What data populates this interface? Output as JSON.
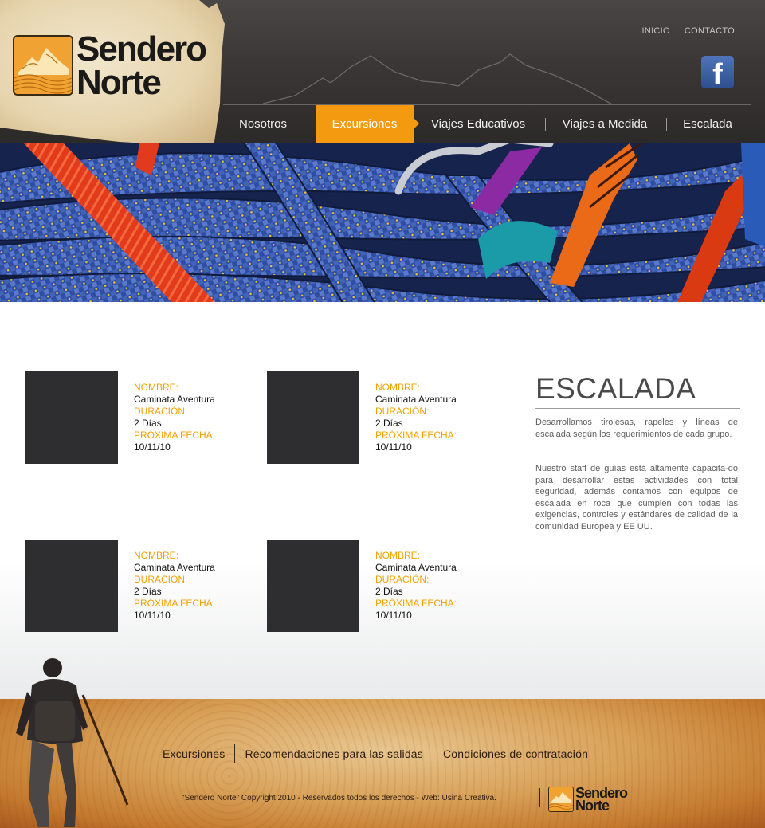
{
  "brand": {
    "name_line1": "Sendero",
    "name_line2": "Norte"
  },
  "top_links": [
    "INICIO",
    "CONTACTO"
  ],
  "social": {
    "facebook_icon": "facebook-icon",
    "glyph": "f"
  },
  "nav": {
    "items": [
      "Nosotros",
      "Excursiones",
      "Viajes Educativos",
      "Viajes a Medida",
      "Escalada"
    ],
    "active": "Excursiones"
  },
  "banner": {
    "image": "climbing-ropes-and-carabiners-photo"
  },
  "cards": [
    {
      "label_name": "NOMBRE:",
      "name": "Caminata Aventura",
      "label_duration": "DURACIÓN:",
      "duration": "2 Días",
      "label_date": "PRÓXIMA FECHA:",
      "date": "10/11/10"
    },
    {
      "label_name": "NOMBRE:",
      "name": "Caminata Aventura",
      "label_duration": "DURACIÓN:",
      "duration": "2 Días",
      "label_date": "PRÓXIMA FECHA:",
      "date": "10/11/10"
    },
    {
      "label_name": "NOMBRE:",
      "name": "Caminata Aventura",
      "label_duration": "DURACIÓN:",
      "duration": "2 Días",
      "label_date": "PRÓXIMA FECHA:",
      "date": "10/11/10"
    },
    {
      "label_name": "NOMBRE:",
      "name": "Caminata Aventura",
      "label_duration": "DURACIÓN:",
      "duration": "2 Días",
      "label_date": "PRÓXIMA FECHA:",
      "date": "10/11/10"
    }
  ],
  "section": {
    "title": "ESCALADA",
    "paragraph1": "Desarrollamos tirolesas, rapeles y líneas de escalada según los requerimientos de cada grupo.",
    "paragraph2": "Nuestro staff de guías está altamente capacita-do para desarrollar estas actividades con total seguridad, además contamos con equipos de escalada en roca que cumplen con todas las exigencias, controles y estándares de calidad de la comunidad Europea y EE UU."
  },
  "footer": {
    "links": [
      "Excursiones",
      "Recomendaciones para las salidas",
      "Condiciones de contratación"
    ],
    "copyright": "\"Sendero Norte\" Copyright 2010 - Reservados todos los derechos - Web: Usina Creativa.",
    "logo_line1": "Sendero",
    "logo_line2": "Norte"
  },
  "colors": {
    "accent": "#f39a11",
    "header": "#3a3736",
    "card_thumb": "#2e2d2f",
    "label": "#f2a200"
  }
}
